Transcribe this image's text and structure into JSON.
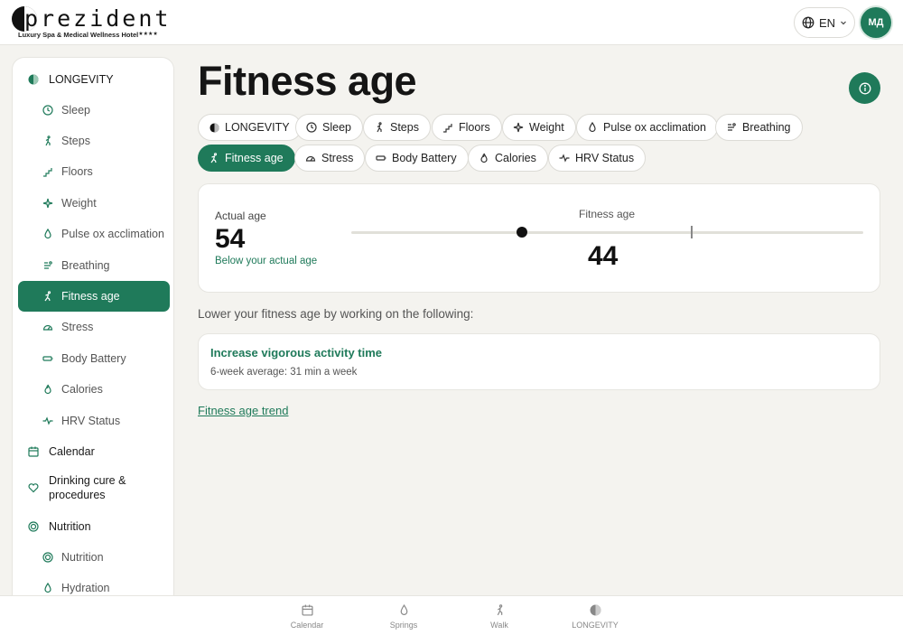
{
  "header": {
    "logo_text": "prezident",
    "logo_subtitle": "Luxury Spa & Medical Wellness Hotel",
    "logo_stars": "★★★★",
    "language": "EN",
    "avatar_initials": "МД"
  },
  "sidebar": {
    "longevity": "LONGEVITY",
    "sleep": "Sleep",
    "steps": "Steps",
    "floors": "Floors",
    "weight": "Weight",
    "pulse_ox": "Pulse ox acclimation",
    "breathing": "Breathing",
    "fitness_age": "Fitness age",
    "stress": "Stress",
    "body_battery": "Body Battery",
    "calories": "Calories",
    "hrv_status": "HRV Status",
    "calendar": "Calendar",
    "drinking_cure": "Drinking cure & procedures",
    "nutrition_group": "Nutrition",
    "nutrition": "Nutrition",
    "hydration": "Hydration"
  },
  "page": {
    "title": "Fitness age"
  },
  "chips": {
    "longevity": "LONGEVITY",
    "sleep": "Sleep",
    "steps": "Steps",
    "floors": "Floors",
    "weight": "Weight",
    "pulse_ox": "Pulse ox acclimation",
    "breathing": "Breathing",
    "fitness_age": "Fitness age",
    "stress": "Stress",
    "body_battery": "Body Battery",
    "calories": "Calories",
    "hrv_status": "HRV Status"
  },
  "age_card": {
    "actual_label": "Actual age",
    "actual_value": "54",
    "status": "Below your actual age",
    "fitness_label": "Fitness age",
    "fitness_value": "44"
  },
  "advice": {
    "intro": "Lower your fitness age by working on the following:",
    "tip_title": "Increase vigorous activity time",
    "tip_detail": "6-week average: 31 min a week"
  },
  "trend_link": "Fitness age trend",
  "bottom_nav": {
    "calendar": "Calendar",
    "springs": "Springs",
    "walk": "Walk",
    "longevity": "LONGEVITY"
  },
  "colors": {
    "accent": "#1f7a5a",
    "background": "#f4f3ef"
  }
}
